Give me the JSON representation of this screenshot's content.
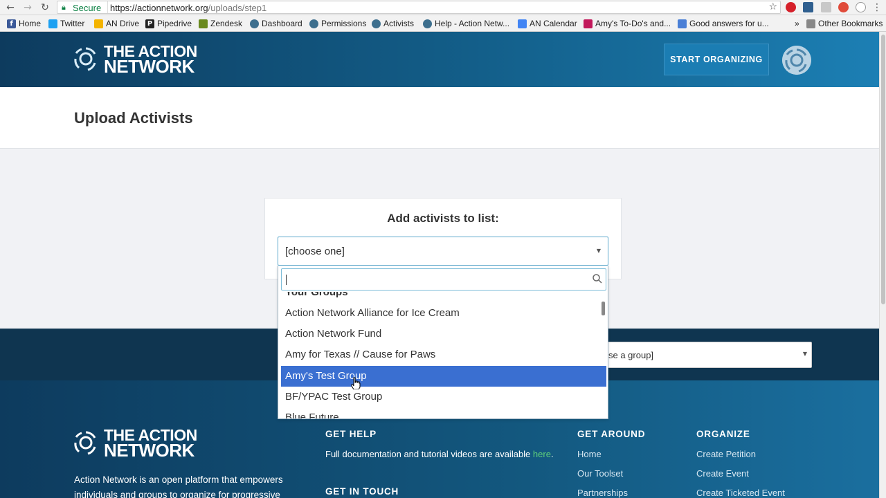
{
  "browser": {
    "secure_label": "Secure",
    "url_host": "https://actionnetwork.org",
    "url_path": "/uploads/step1",
    "bookmarks": [
      {
        "label": "Home"
      },
      {
        "label": "Twitter"
      },
      {
        "label": "AN Drive"
      },
      {
        "label": "Pipedrive"
      },
      {
        "label": "Zendesk"
      },
      {
        "label": "Dashboard"
      },
      {
        "label": "Permissions"
      },
      {
        "label": "Activists"
      },
      {
        "label": "Help - Action Netw..."
      },
      {
        "label": "AN Calendar"
      },
      {
        "label": "Amy's To-Do's and..."
      },
      {
        "label": "Good answers for u..."
      }
    ],
    "more_label": "»",
    "other_bookmarks": "Other Bookmarks"
  },
  "header": {
    "logo_line1": "THE ACTION",
    "logo_line2": "NETWORK",
    "start_button": "START ORGANIZING"
  },
  "page": {
    "title": "Upload Activists"
  },
  "form": {
    "label": "Add activists to list:",
    "select_value": "[choose one]",
    "group_select_value": "se a group]"
  },
  "dropdown": {
    "group_header": "Your Groups",
    "items": [
      {
        "label": "Action Network Alliance for Ice Cream"
      },
      {
        "label": "Action Network Fund"
      },
      {
        "label": "Amy for Texas // Cause for Paws"
      },
      {
        "label": "Amy's Test Group"
      },
      {
        "label": "BF/YPAC Test Group"
      },
      {
        "label": "Blue Future"
      }
    ],
    "active_index": 3
  },
  "footer": {
    "about": "Action Network is an open platform that empowers individuals and groups to organize for progressive causes.",
    "get_help": {
      "heading": "GET HELP",
      "text": "Full documentation and tutorial videos are available",
      "link": "here",
      "end": "."
    },
    "get_in_touch": {
      "heading": "GET IN TOUCH"
    },
    "get_around": {
      "heading": "GET AROUND",
      "links": [
        "Home",
        "Our Toolset",
        "Partnerships"
      ]
    },
    "organize": {
      "heading": "ORGANIZE",
      "links": [
        "Create Petition",
        "Create Event",
        "Create Ticketed Event"
      ]
    }
  },
  "colors": {
    "brand_dark": "#0d3b5e",
    "brand_light": "#1c7fb4",
    "highlight": "#3a6fd1",
    "link_green": "#5fd07a"
  }
}
